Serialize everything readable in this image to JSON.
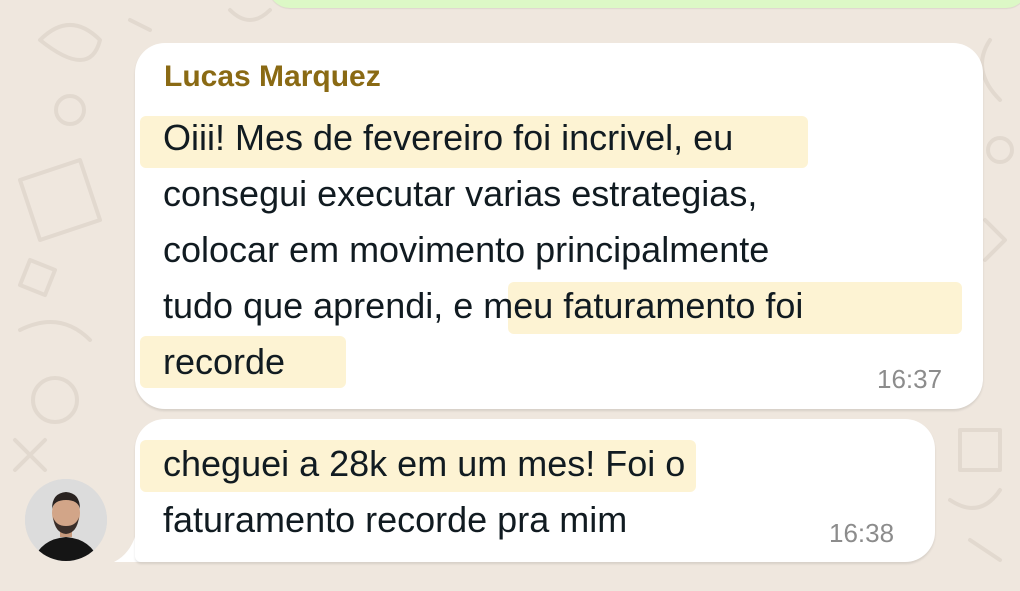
{
  "chat": {
    "messages": [
      {
        "sender": "Lucas Marquez",
        "lines": [
          "Oiii! Mes de fevereiro foi incrivel, eu",
          "consegui executar varias estrategias,",
          "colocar em movimento principalmente",
          "tudo que aprendi, e meu faturamento foi",
          "recorde"
        ],
        "time": "16:37"
      },
      {
        "lines": [
          "cheguei a 28k em um mes! Foi o",
          "faturamento recorde pra mim"
        ],
        "time": "16:38"
      }
    ]
  },
  "colors": {
    "wallpaper": "#efe7de",
    "bubble": "#ffffff",
    "sender_name": "#8a6a14",
    "highlight": "#fdf3d3",
    "outgoing_bubble": "#dcf8c6"
  }
}
